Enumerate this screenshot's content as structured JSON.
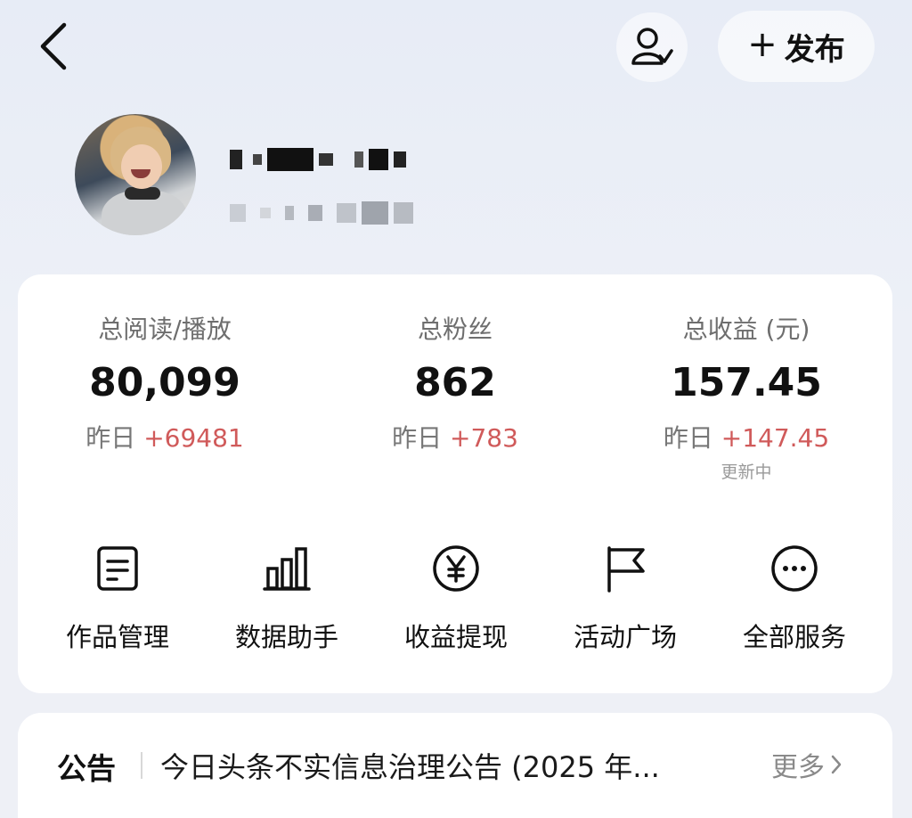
{
  "header": {
    "back_icon": "chevron-left-icon",
    "user_icon": "user-verify-icon",
    "publish_label": "发布",
    "publish_icon": "plus-icon"
  },
  "stats": [
    {
      "label": "总阅读/播放",
      "value": "80,099",
      "delta_prefix": "昨日",
      "delta": "+69481",
      "note": ""
    },
    {
      "label": "总粉丝",
      "value": "862",
      "delta_prefix": "昨日",
      "delta": "+783",
      "note": ""
    },
    {
      "label": "总收益 (元)",
      "value": "157.45",
      "delta_prefix": "昨日",
      "delta": "+147.45",
      "note": "更新中"
    }
  ],
  "tools": [
    {
      "label": "作品管理",
      "icon": "document-icon"
    },
    {
      "label": "数据助手",
      "icon": "bar-chart-icon"
    },
    {
      "label": "收益提现",
      "icon": "yen-circle-icon"
    },
    {
      "label": "活动广场",
      "icon": "flag-icon"
    },
    {
      "label": "全部服务",
      "icon": "more-circle-icon"
    }
  ],
  "notice": {
    "title": "公告",
    "text": "今日头条不实信息治理公告 (2025 年...",
    "more_label": "更多"
  },
  "colors": {
    "accent_red": "#d05a5a",
    "background": "#eef1f8",
    "card": "#ffffff"
  }
}
